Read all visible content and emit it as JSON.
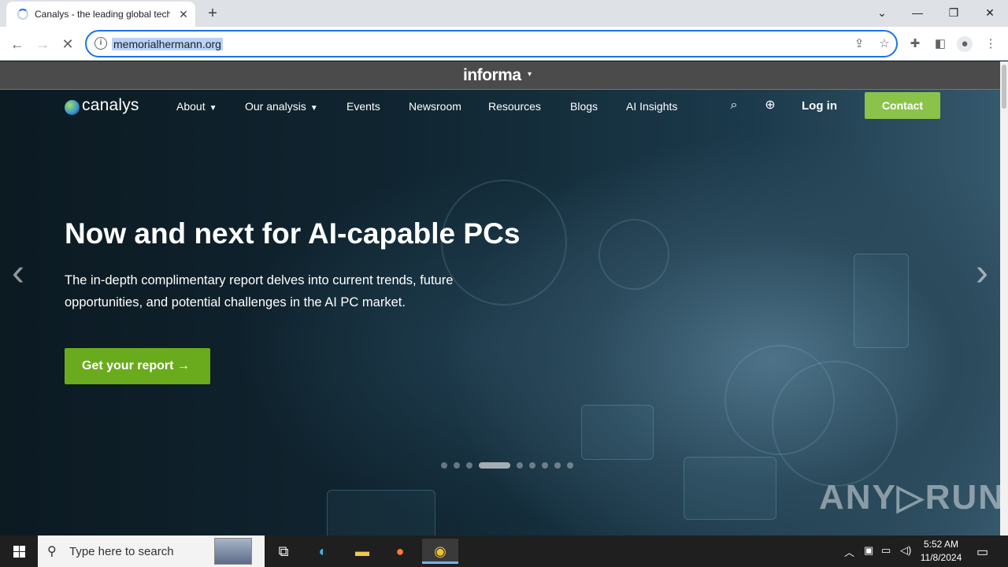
{
  "browser": {
    "tab_title": "Canalys - the leading global tech",
    "new_tab_label": "+",
    "url": "memorialhermann.org",
    "window_controls": {
      "collapse_icon": "chevron-down-icon",
      "minimize": "—",
      "restore": "❐",
      "close": "✕"
    }
  },
  "page": {
    "informa": {
      "label": "informa",
      "caret": "▾"
    },
    "logo_text": "canalys",
    "nav": [
      {
        "label": "About",
        "has_menu": true
      },
      {
        "label": "Our analysis",
        "has_menu": true
      },
      {
        "label": "Events"
      },
      {
        "label": "Newsroom"
      },
      {
        "label": "Resources"
      },
      {
        "label": "Blogs"
      },
      {
        "label": "AI Insights"
      }
    ],
    "login_label": "Log in",
    "contact_label": "Contact",
    "hero": {
      "title": "Now and next for AI-capable PCs",
      "text": "The in-depth complimentary report delves into current trends, future opportunities, and potential challenges in the AI PC market.",
      "cta_label": "Get your report  →"
    },
    "carousel": {
      "slide_count": 9,
      "active_index": 3,
      "prev_icon": "chevron-left-icon",
      "next_icon": "chevron-right-icon"
    },
    "watermark": "ANY▷RUN"
  },
  "taskbar": {
    "search_placeholder": "Type here to search",
    "clock_time": "5:52 AM",
    "clock_date": "11/8/2024"
  },
  "colors": {
    "cta_green": "#6aab1e",
    "contact_green": "#8bc34a",
    "omnibox_focus": "#1a73e8"
  }
}
